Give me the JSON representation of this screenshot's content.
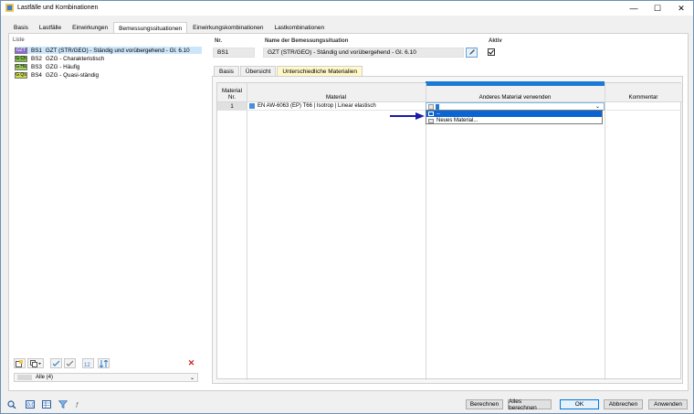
{
  "window": {
    "title": "Lastfälle und Kombinationen",
    "minimize": "—",
    "maximize": "☐",
    "close": "✕"
  },
  "tabs": [
    {
      "label": "Basis"
    },
    {
      "label": "Lastfälle"
    },
    {
      "label": "Einwirkungen"
    },
    {
      "label": "Bemessungssituationen",
      "active": true
    },
    {
      "label": "Einwirkungskombinationen"
    },
    {
      "label": "Lastkombinationen"
    }
  ],
  "list": {
    "header": "Liste",
    "items": [
      {
        "badge": "GZT",
        "badge_color": "#8a6bd4",
        "code": "BS1",
        "text": "GZT (STR/GEO) - Ständig und vorübergehend - Gl. 6.10",
        "selected": true
      },
      {
        "badge": "G Ch",
        "badge_color": "#7fbf3f",
        "code": "BS2",
        "text": "GZG - Charakteristisch"
      },
      {
        "badge": "G Hä",
        "badge_color": "#9ccf5c",
        "code": "BS3",
        "text": "GZG - Häufig"
      },
      {
        "badge": "G Qs",
        "badge_color": "#c8dc4a",
        "code": "BS4",
        "text": "GZG - Quasi-ständig"
      }
    ],
    "filter_value": "Alle (4)"
  },
  "details": {
    "nr_label": "Nr.",
    "nr_value": "BS1",
    "name_label": "Name der Bemessungssituation",
    "name_value": "GZT (STR/GEO) - Ständig und vorübergehend - Gl. 6.10",
    "aktiv_label": "Aktiv",
    "aktiv_checked": true
  },
  "subtabs": [
    {
      "label": "Basis"
    },
    {
      "label": "Übersicht"
    },
    {
      "label": "Unterschiedliche Materialien",
      "active": true
    }
  ],
  "table": {
    "col_nr_line1": "Material",
    "col_nr_line2": "Nr.",
    "col_material": "Material",
    "col_other": "Anderes Material verwenden",
    "col_comment": "Kommentar",
    "rows": [
      {
        "nr": "1",
        "material": "EN AW-6063 (EP) T66 | Isotrop | Linear elastisch",
        "material_color": "#4a90d9",
        "other": ""
      }
    ],
    "dropdown_options": [
      "--",
      "Neues Material..."
    ]
  },
  "footer": {
    "berechnen": "Berechnen",
    "alles_berechnen": "Alles berechnen",
    "ok": "OK",
    "abbrechen": "Abbrechen",
    "anwenden": "Anwenden"
  }
}
